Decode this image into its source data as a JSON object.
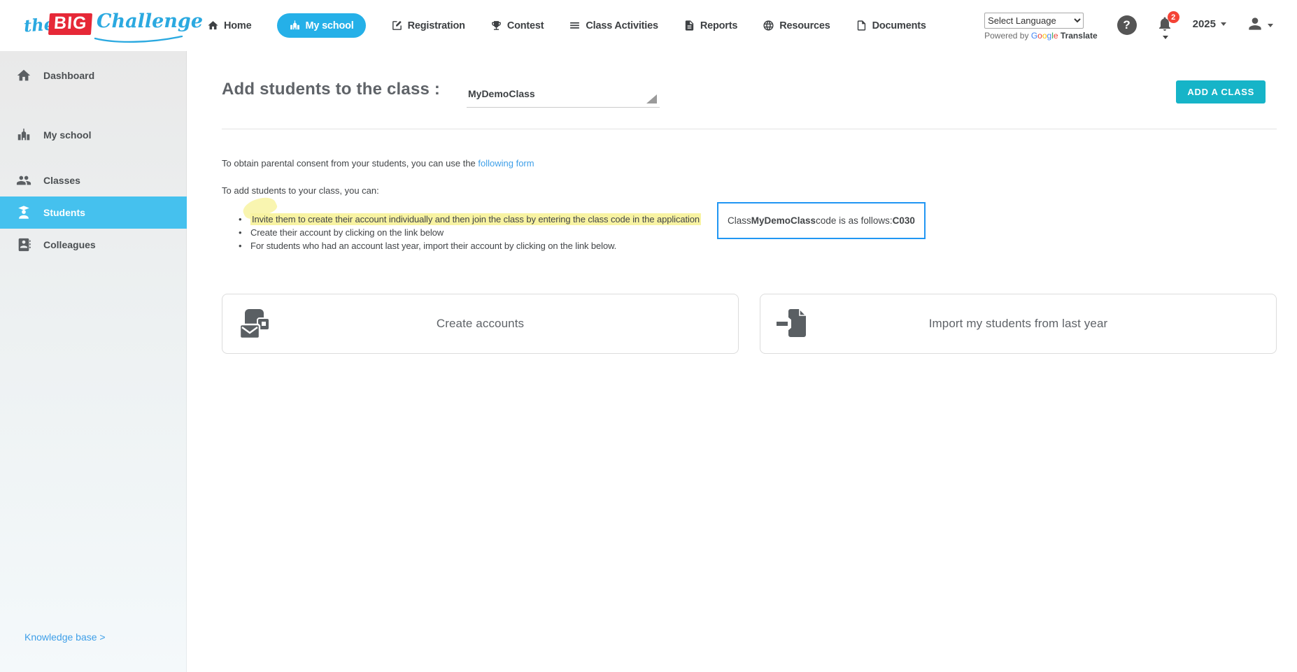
{
  "brand": {
    "the": "the",
    "big": "BIG",
    "challenge": "Challenge"
  },
  "nav": {
    "items": [
      {
        "label": "Home"
      },
      {
        "label": "My school"
      },
      {
        "label": "Registration"
      },
      {
        "label": "Contest"
      },
      {
        "label": "Class Activities"
      },
      {
        "label": "Reports"
      },
      {
        "label": "Resources"
      },
      {
        "label": "Documents"
      }
    ],
    "language_select": {
      "value": "Select Language"
    },
    "translate_credit": {
      "prefix": "Powered by",
      "google_letters": [
        "G",
        "o",
        "o",
        "g",
        "l",
        "e"
      ],
      "suffix": "Translate"
    },
    "help_glyph": "?",
    "notification_count": "2",
    "year": "2025"
  },
  "sidebar": {
    "items": [
      {
        "label": "Dashboard"
      },
      {
        "label": "My school"
      },
      {
        "label": "Classes"
      },
      {
        "label": "Students"
      },
      {
        "label": "Colleagues"
      }
    ],
    "knowledge_base_link": "Knowledge base >"
  },
  "main": {
    "title": "Add students to the class :",
    "class_select": {
      "value": "MyDemoClass"
    },
    "add_class_button": "ADD A CLASS",
    "consent_text": "To obtain parental consent from your students, you can use the ",
    "consent_link": "following form",
    "intro": "To add students to your class, you can:",
    "bullets": [
      "Invite them to create their account individually and then join the class by entering the class code in the application",
      "Create their account by clicking on the link below",
      "For students who had an account last year, import their account by clicking on the link below."
    ],
    "code_box": {
      "prefix": "Class ",
      "class_name": "MyDemoClass",
      "middle": " code is as follows: ",
      "code": "C030"
    },
    "cards": [
      {
        "label": "Create accounts"
      },
      {
        "label": "Import my students from last year"
      }
    ]
  },
  "colors": {
    "nav_active": "#25b0e8",
    "sidebar_active": "#45c1ee",
    "add_button_teal": "#16b4c8",
    "link_blue": "#3e9fe8",
    "code_box_border": "#2196f3",
    "badge_red": "#f44336",
    "logo_red": "#e62837",
    "logo_blue": "#2ba9e0",
    "highlight_yellow": "#f8f3a2"
  }
}
